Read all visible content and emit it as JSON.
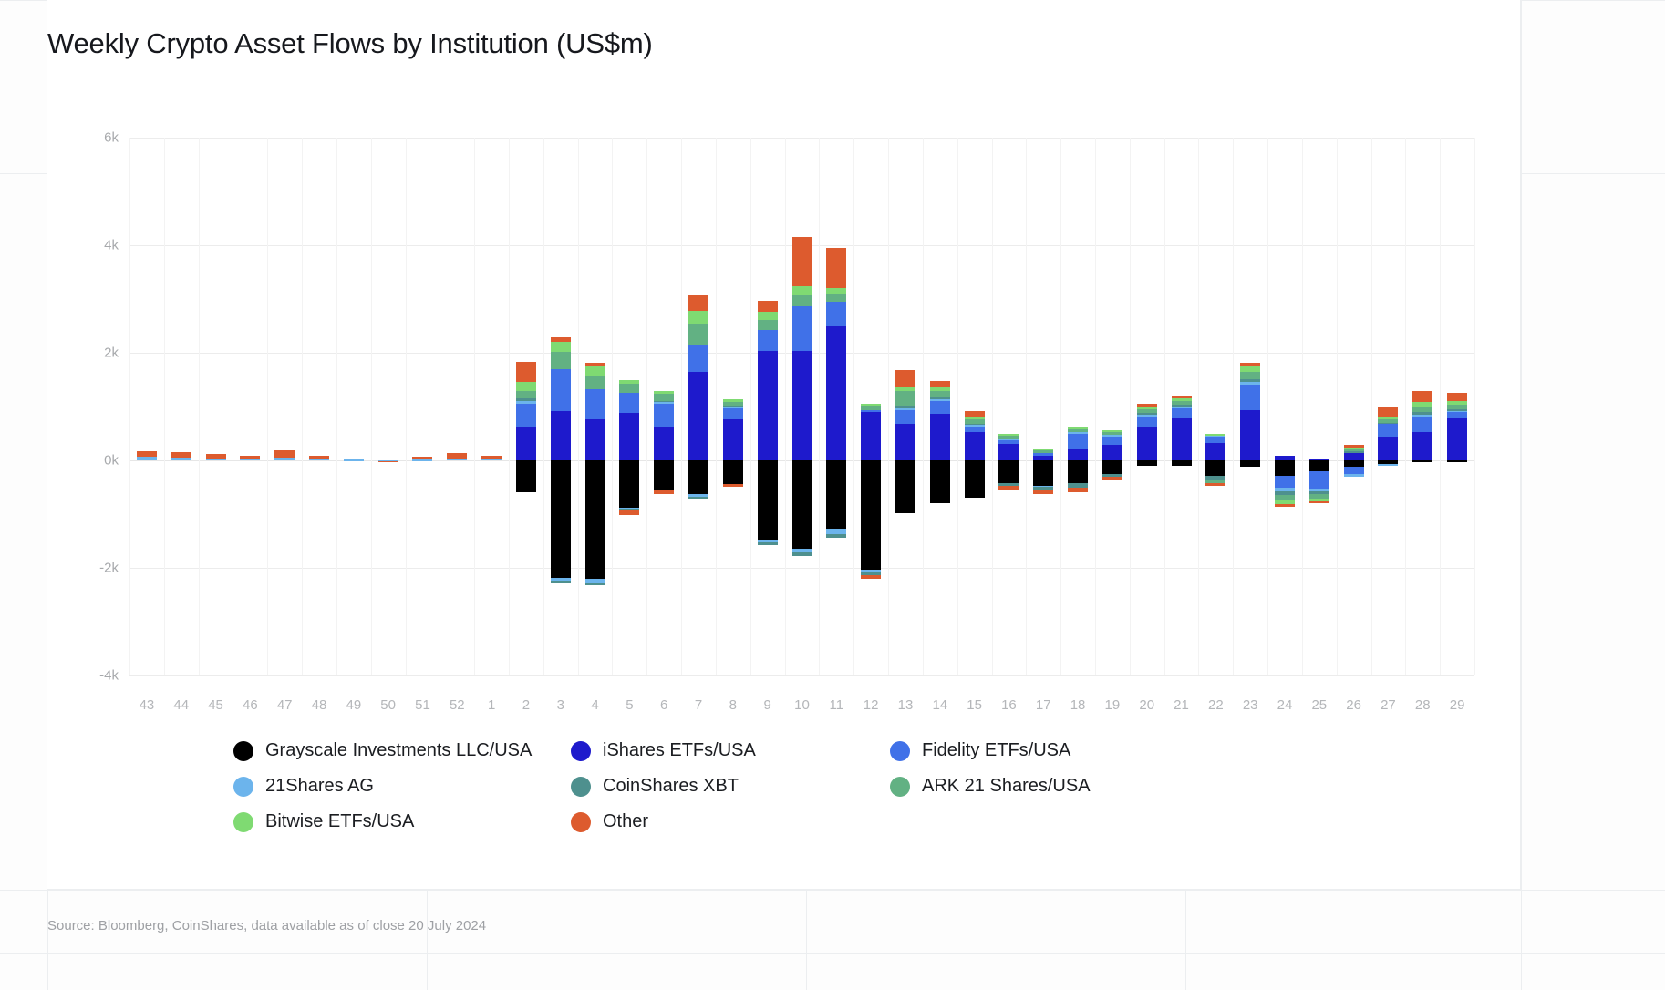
{
  "header": {
    "title": "Weekly Crypto Asset Flows by Institution (US$m)"
  },
  "footer": {
    "source": "Source: Bloomberg, CoinShares, data available as of close 20 July 2024"
  },
  "legend": {
    "items": [
      {
        "label": "Grayscale Investments LLC/USA",
        "color": "#000000",
        "key": "grayscale"
      },
      {
        "label": "iShares ETFs/USA",
        "color": "#1e1acc",
        "key": "ishares"
      },
      {
        "label": "Fidelity ETFs/USA",
        "color": "#4071e8",
        "key": "fidelity"
      },
      {
        "label": "21Shares AG",
        "color": "#6cb4ec",
        "key": "21shares"
      },
      {
        "label": "CoinShares XBT",
        "color": "#4e908e",
        "key": "coinshares"
      },
      {
        "label": "ARK 21 Shares/USA",
        "color": "#62b183",
        "key": "ark21"
      },
      {
        "label": "Bitwise ETFs/USA",
        "color": "#7fda72",
        "key": "bitwise"
      },
      {
        "label": "Other",
        "color": "#dd5b2e",
        "key": "other"
      }
    ]
  },
  "chart_data": {
    "type": "bar",
    "stacked": true,
    "title": "Weekly Crypto Asset Flows by Institution (US$m)",
    "xlabel": "",
    "ylabel": "",
    "ylim": [
      -4000,
      6000
    ],
    "yticks": [
      6000,
      4000,
      2000,
      0,
      -2000,
      -4000
    ],
    "ytick_labels": [
      "6k",
      "4k",
      "2k",
      "0k",
      "-2k",
      "-4k"
    ],
    "grid": true,
    "legend_position": "bottom",
    "categories": [
      "43",
      "44",
      "45",
      "46",
      "47",
      "48",
      "49",
      "50",
      "51",
      "52",
      "1",
      "2",
      "3",
      "4",
      "5",
      "6",
      "7",
      "8",
      "9",
      "10",
      "11",
      "12",
      "13",
      "14",
      "15",
      "16",
      "17",
      "18",
      "19",
      "20",
      "21",
      "22",
      "23",
      "24",
      "25",
      "26",
      "27",
      "28",
      "29"
    ],
    "series": [
      {
        "name": "Grayscale Investments LLC/USA",
        "color": "#000000",
        "values": [
          0,
          0,
          0,
          0,
          0,
          0,
          0,
          0,
          0,
          0,
          0,
          -600,
          -2180,
          -2210,
          -880,
          -560,
          -630,
          -440,
          -1480,
          -1650,
          -1270,
          -2040,
          -990,
          -800,
          -700,
          -420,
          -480,
          -430,
          -260,
          -100,
          -110,
          -290,
          -120,
          -280,
          -210,
          -120,
          -70,
          -30,
          -20
        ]
      },
      {
        "name": "iShares ETFs/USA",
        "color": "#1e1acc",
        "values": [
          0,
          0,
          0,
          0,
          0,
          0,
          0,
          0,
          0,
          0,
          0,
          620,
          920,
          760,
          880,
          620,
          1640,
          760,
          2030,
          2030,
          2490,
          900,
          670,
          860,
          520,
          300,
          90,
          200,
          290,
          630,
          790,
          330,
          930,
          80,
          40,
          140,
          440,
          520,
          780
        ]
      },
      {
        "name": "Fidelity ETFs/USA",
        "color": "#4071e8",
        "values": [
          0,
          0,
          0,
          0,
          0,
          0,
          0,
          0,
          0,
          0,
          0,
          430,
          780,
          560,
          380,
          430,
          500,
          210,
          400,
          840,
          460,
          40,
          270,
          240,
          110,
          70,
          50,
          290,
          160,
          180,
          170,
          110,
          470,
          -230,
          -320,
          -130,
          230,
          300,
          120
        ]
      },
      {
        "name": "21Shares AG",
        "color": "#6cb4ec",
        "values": [
          60,
          50,
          40,
          30,
          50,
          20,
          10,
          -10,
          10,
          40,
          30,
          60,
          -60,
          -70,
          -20,
          30,
          -50,
          20,
          -40,
          -60,
          -110,
          -50,
          30,
          40,
          30,
          20,
          -10,
          30,
          20,
          40,
          40,
          20,
          60,
          -60,
          -40,
          -60,
          -40,
          30,
          20
        ]
      },
      {
        "name": "CoinShares XBT",
        "color": "#4e908e",
        "values": [
          0,
          0,
          0,
          0,
          0,
          0,
          0,
          0,
          0,
          0,
          0,
          40,
          -40,
          -40,
          -30,
          30,
          -30,
          20,
          -60,
          -70,
          -60,
          -40,
          40,
          30,
          20,
          -50,
          -60,
          -80,
          -50,
          30,
          30,
          -60,
          50,
          -70,
          -60,
          30,
          30,
          40,
          30
        ]
      },
      {
        "name": "ARK 21 Shares/USA",
        "color": "#62b183",
        "values": [
          0,
          0,
          0,
          0,
          0,
          0,
          0,
          0,
          0,
          0,
          0,
          130,
          310,
          250,
          170,
          120,
          410,
          70,
          180,
          200,
          140,
          70,
          280,
          120,
          90,
          60,
          40,
          60,
          50,
          70,
          70,
          -80,
          130,
          -110,
          -80,
          30,
          70,
          110,
          90
        ]
      },
      {
        "name": "Bitwise ETFs/USA",
        "color": "#7fda72",
        "values": [
          0,
          0,
          0,
          0,
          0,
          0,
          0,
          0,
          0,
          0,
          0,
          170,
          190,
          170,
          70,
          60,
          230,
          50,
          160,
          170,
          120,
          40,
          90,
          60,
          50,
          40,
          30,
          50,
          40,
          50,
          50,
          40,
          110,
          -60,
          -60,
          30,
          50,
          90,
          60
        ]
      },
      {
        "name": "Other",
        "color": "#dd5b2e",
        "values": [
          110,
          110,
          80,
          60,
          130,
          70,
          30,
          -20,
          50,
          90,
          60,
          380,
          90,
          70,
          -90,
          -60,
          280,
          -60,
          190,
          920,
          740,
          -80,
          300,
          130,
          90,
          -70,
          -70,
          -80,
          -70,
          50,
          50,
          -50,
          70,
          -50,
          -30,
          50,
          180,
          190,
          160
        ]
      }
    ]
  }
}
